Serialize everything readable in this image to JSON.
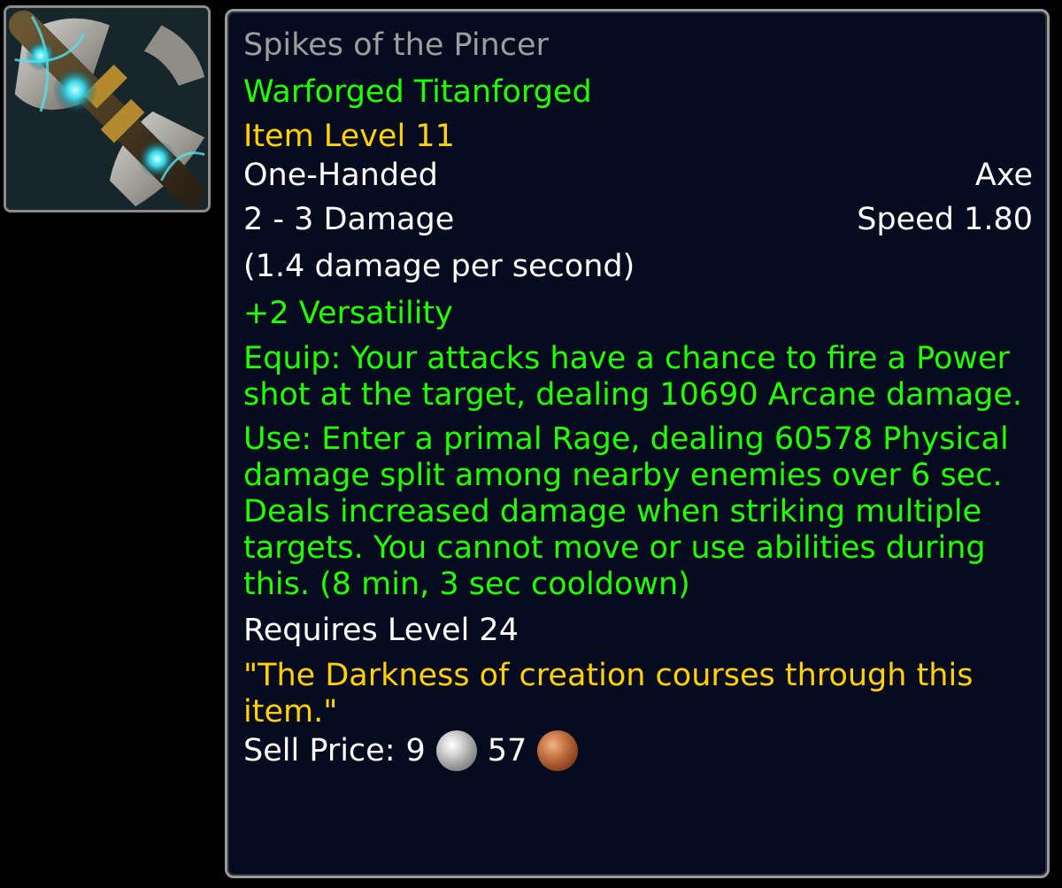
{
  "item": {
    "name": "Spikes of the Pincer",
    "upgrade": "Warforged Titanforged",
    "item_level": "Item Level 11",
    "slot": "One-Handed",
    "type": "Axe",
    "damage": "2 - 3 Damage",
    "speed": "Speed 1.80",
    "dps": "(1.4 damage per second)",
    "stat": "+2 Versatility",
    "equip_effect": "Equip: Your attacks have a chance to fire a Power shot at the target, dealing 10690 Arcane damage.",
    "use_effect": "Use: Enter a primal Rage, dealing 60578 Physical damage split among nearby enemies over 6 sec. Deals increased damage when striking multiple targets. You cannot move or use abilities during this. (8 min, 3 sec cooldown)",
    "requirement": "Requires Level 24",
    "flavor_text": "\"The Darkness of creation courses through this item.\"",
    "sell_price": {
      "label": "Sell Price:",
      "silver": "9",
      "copper": "57"
    }
  },
  "icon": {
    "name": "axe-icon"
  },
  "colors": {
    "poor_name": "#9d9d9d",
    "effect_green": "#1eff00",
    "item_level_gold": "#ffd100",
    "flavor_gold": "#ffd100",
    "text_white": "#ffffff",
    "tooltip_bg": "#070b1f"
  }
}
